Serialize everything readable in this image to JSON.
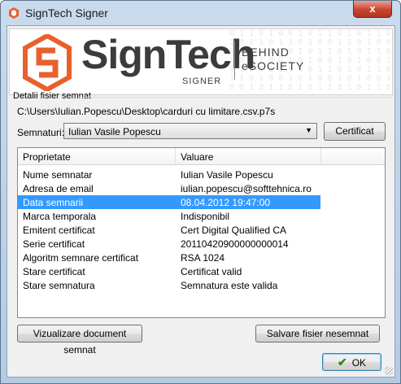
{
  "window": {
    "title": "SignTech Signer",
    "close_label": "x"
  },
  "banner": {
    "brand": "SignTech",
    "brand_sub": "SIGNER",
    "tagline_line1": "BEHIND",
    "tagline_line2": "eSOCIETY",
    "accent_color": "#e8602c"
  },
  "details": {
    "group_label": "Detalii fisier semnat",
    "file_path": "C:\\Users\\Iulian.Popescu\\Desktop\\carduri cu limitare.csv.p7s",
    "signer_label": "Semnaturi:",
    "signer_value": "Iulian Vasile Popescu",
    "certificate_button": "Certificat"
  },
  "table": {
    "columns": [
      "Proprietate",
      "Valuare"
    ],
    "rows": [
      {
        "prop": "Nume semnatar",
        "value": "Iulian Vasile Popescu"
      },
      {
        "prop": "Adresa de email",
        "value": "iulian.popescu@softtehnica.ro"
      },
      {
        "prop": "Data semnarii",
        "value": "08.04.2012 19:47:00",
        "selected": true
      },
      {
        "prop": "Marca temporala",
        "value": "Indisponibil"
      },
      {
        "prop": "Emitent certificat",
        "value": "Cert Digital Qualified CA"
      },
      {
        "prop": "Serie certificat",
        "value": "20110420900000000014"
      },
      {
        "prop": "Algoritm semnare certificat",
        "value": "RSA 1024"
      },
      {
        "prop": "Stare certificat",
        "value": "Certificat valid"
      },
      {
        "prop": "Stare semnatura",
        "value": "Semnatura este valida"
      }
    ]
  },
  "buttons": {
    "view_document": "Vizualizare document semnat",
    "save_unsigned": "Salvare fisier nesemnat",
    "ok": "OK"
  }
}
